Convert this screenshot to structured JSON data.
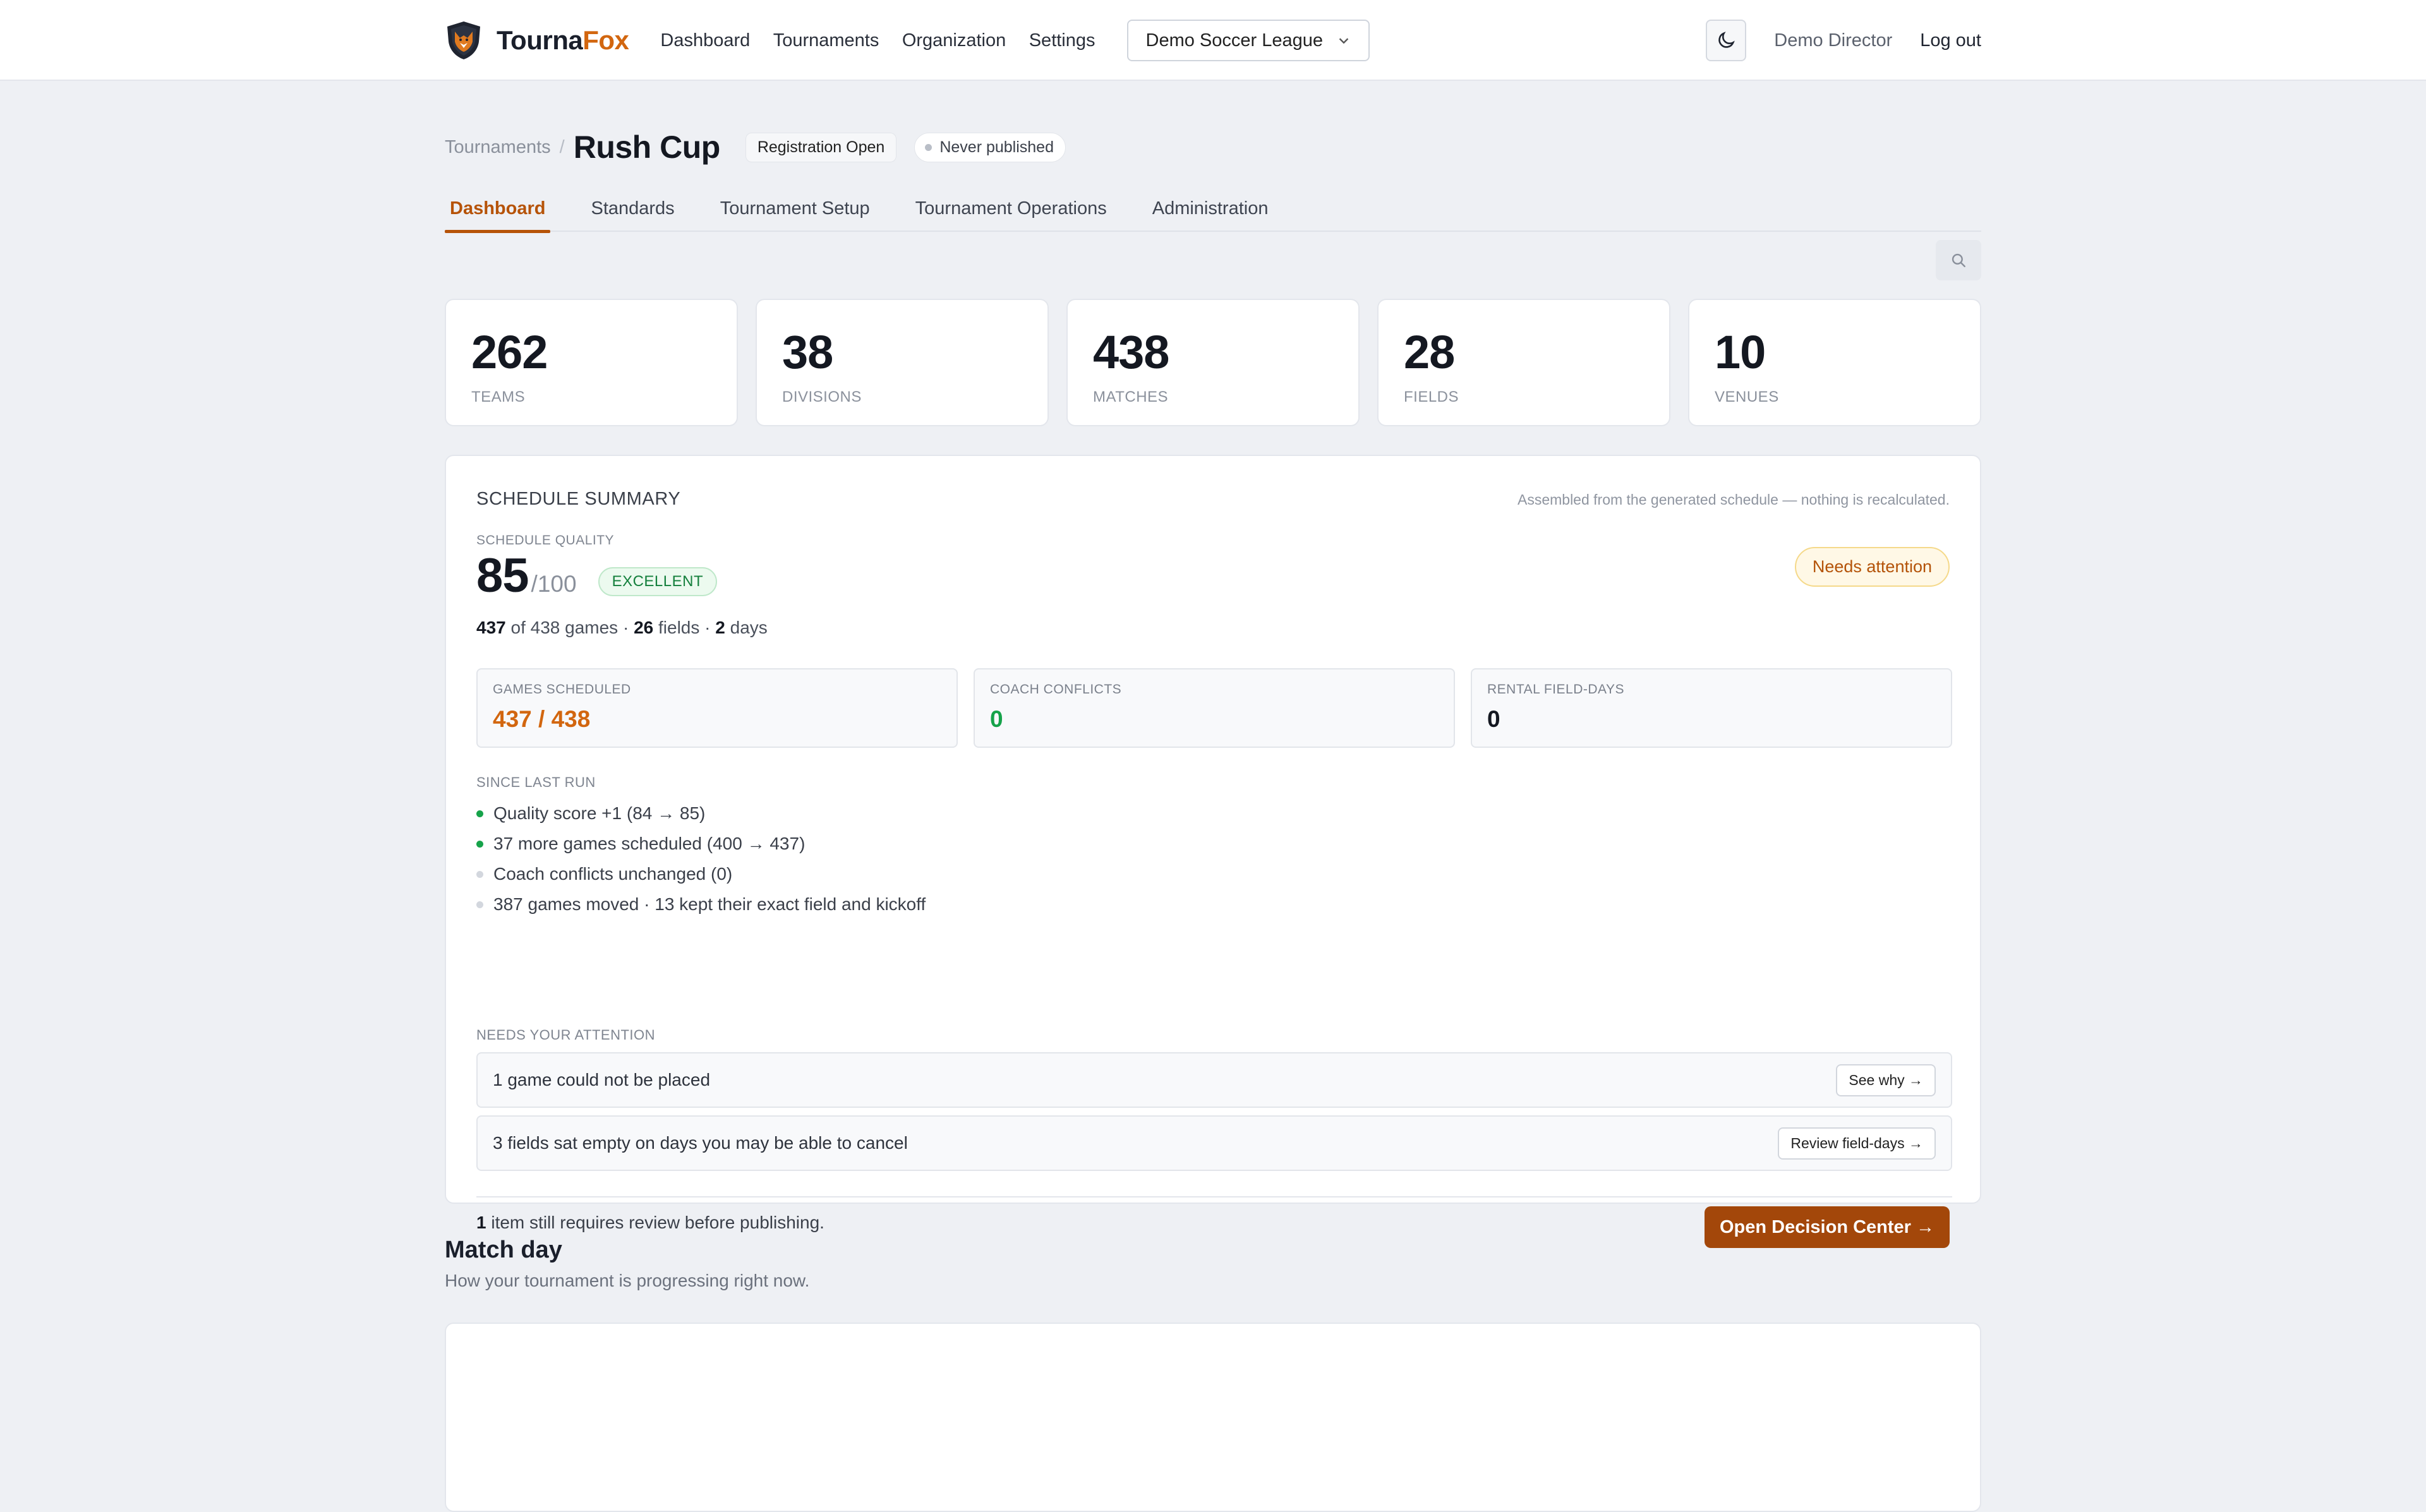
{
  "brand": {
    "part1": "Tourna",
    "part2": "Fox",
    "accent": "#d2660f"
  },
  "nav": {
    "items": [
      "Dashboard",
      "Tournaments",
      "Organization",
      "Settings"
    ]
  },
  "org_select": {
    "value": "Demo Soccer League"
  },
  "user": {
    "name": "Demo Director",
    "logout": "Log out"
  },
  "icons": {
    "theme": "moon-icon",
    "search": "search-icon",
    "org_chevron": "chevron-down-icon",
    "logo": "fox-shield-logo"
  },
  "breadcrumb": {
    "root": "Tournaments",
    "separator": "/",
    "title": "Rush Cup"
  },
  "status_pills": {
    "registration": "Registration Open",
    "publish": "Never published"
  },
  "tabs": [
    "Dashboard",
    "Standards",
    "Tournament Setup",
    "Tournament Operations",
    "Administration"
  ],
  "active_tab": "Dashboard",
  "stats": [
    {
      "value": "262",
      "label": "TEAMS"
    },
    {
      "value": "38",
      "label": "DIVISIONS"
    },
    {
      "value": "438",
      "label": "MATCHES"
    },
    {
      "value": "28",
      "label": "FIELDS"
    },
    {
      "value": "10",
      "label": "VENUES"
    }
  ],
  "summary": {
    "title": "SCHEDULE SUMMARY",
    "note": "Assembled from the generated schedule — nothing is recalculated.",
    "quality_label": "SCHEDULE QUALITY",
    "score": "85",
    "score_max": "/100",
    "quality_badge": "EXCELLENT",
    "attention_badge": "Needs attention",
    "games_scheduled_num": "437",
    "games_total_text": "of 438 games",
    "fields_num": "26",
    "fields_text": "fields",
    "days_num": "2",
    "days_text": "days",
    "sep": "·",
    "metrics": [
      {
        "label": "GAMES SCHEDULED",
        "value": "437 / 438",
        "color": "#d2660f"
      },
      {
        "label": "COACH CONFLICTS",
        "value": "0",
        "color": "#16a34a"
      },
      {
        "label": "RENTAL FIELD-DAYS",
        "value": "0",
        "color": "#141821"
      }
    ],
    "since_label": "SINCE LAST RUN",
    "since_items": [
      {
        "text": "Quality score +1 (84 → 85)",
        "status": "positive"
      },
      {
        "text": "37 more games scheduled (400 → 437)",
        "status": "positive"
      },
      {
        "text": "Coach conflicts unchanged (0)",
        "status": "neutral"
      },
      {
        "text": "387 games moved · 13 kept their exact field and kickoff",
        "status": "neutral"
      }
    ],
    "needs_label": "NEEDS YOUR ATTENTION",
    "issues": [
      {
        "text": "1 game could not be placed",
        "action": "See why →"
      },
      {
        "text": "3 fields sat empty on days you may be able to cancel",
        "action": "Review field-days →"
      }
    ],
    "footer_count": "1",
    "footer_text": "item still requires review before publishing.",
    "primary_action": "Open Decision Center →"
  },
  "match_day": {
    "title": "Match day",
    "subtitle": "How your tournament is progressing right now."
  }
}
